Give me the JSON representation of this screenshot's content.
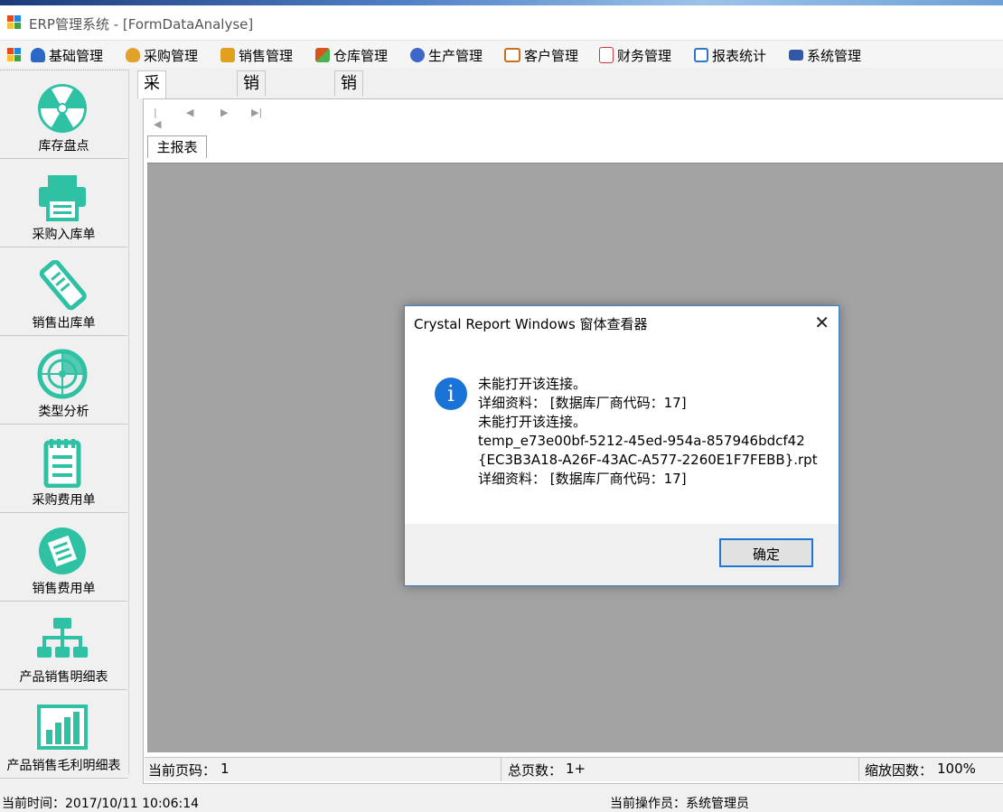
{
  "window": {
    "title": "ERP管理系统 - [FormDataAnalyse]"
  },
  "menu": [
    {
      "label": "基础管理",
      "icon": "users-icon",
      "color": "#2b67c6"
    },
    {
      "label": "采购管理",
      "icon": "money-bag-icon",
      "color": "#e2a12a"
    },
    {
      "label": "销售管理",
      "icon": "sales-tag-icon",
      "color": "#e0a020"
    },
    {
      "label": "仓库管理",
      "icon": "boxes-icon",
      "color": "#d9541c"
    },
    {
      "label": "生产管理",
      "icon": "gear-globe-icon",
      "color": "#3f67c9"
    },
    {
      "label": "客户管理",
      "icon": "customer-card-icon",
      "color": "#c8701c"
    },
    {
      "label": "财务管理",
      "icon": "ledger-icon",
      "color": "#c83a3a"
    },
    {
      "label": "报表统计",
      "icon": "report-icon",
      "color": "#2f77c2"
    },
    {
      "label": "系统管理",
      "icon": "system-monitor-icon",
      "color": "#3357a8"
    }
  ],
  "sidebar": {
    "accent": "#2ec1a4",
    "items": [
      {
        "label": "库存盘点",
        "icon": "radiation-icon"
      },
      {
        "label": "采购入库单",
        "icon": "printer-icon"
      },
      {
        "label": "销售出库单",
        "icon": "receipt-scroll-icon"
      },
      {
        "label": "类型分析",
        "icon": "radar-icon"
      },
      {
        "label": "采购费用单",
        "icon": "notepad-icon"
      },
      {
        "label": "销售费用单",
        "icon": "document-circle-icon"
      },
      {
        "label": "产品销售明细表",
        "icon": "org-chart-icon"
      },
      {
        "label": "产品销售毛利明细表",
        "icon": "bar-chart-icon"
      }
    ]
  },
  "tabs": [
    {
      "label": "采购汇总表",
      "active": true
    },
    {
      "label": "销售汇总表",
      "active": false
    },
    {
      "label": "销售毛利汇总表",
      "active": false
    }
  ],
  "viewer": {
    "subtab": "主报表",
    "status": {
      "current_page_label": "当前页码：",
      "current_page": "1",
      "total_pages_label": "总页数：",
      "total_pages": "1+",
      "zoom_label": "缩放因数：",
      "zoom": "100%"
    }
  },
  "dialog": {
    "title": "Crystal Report Windows 窗体查看器",
    "messages": [
      "未能打开该连接。",
      "详细资料：  [数据库厂商代码：17]",
      "未能打开该连接。",
      "temp_e73e00bf-5212-45ed-954a-857946bdcf42",
      "{EC3B3A18-A26F-43AC-A577-2260E1F7FEBB}.rpt",
      "详细资料：  [数据库厂商代码：17]"
    ],
    "ok_label": "确定"
  },
  "footer": {
    "time": "当前时间：2017/10/11 10:06:14",
    "operator": "当前操作员：系统管理员"
  }
}
